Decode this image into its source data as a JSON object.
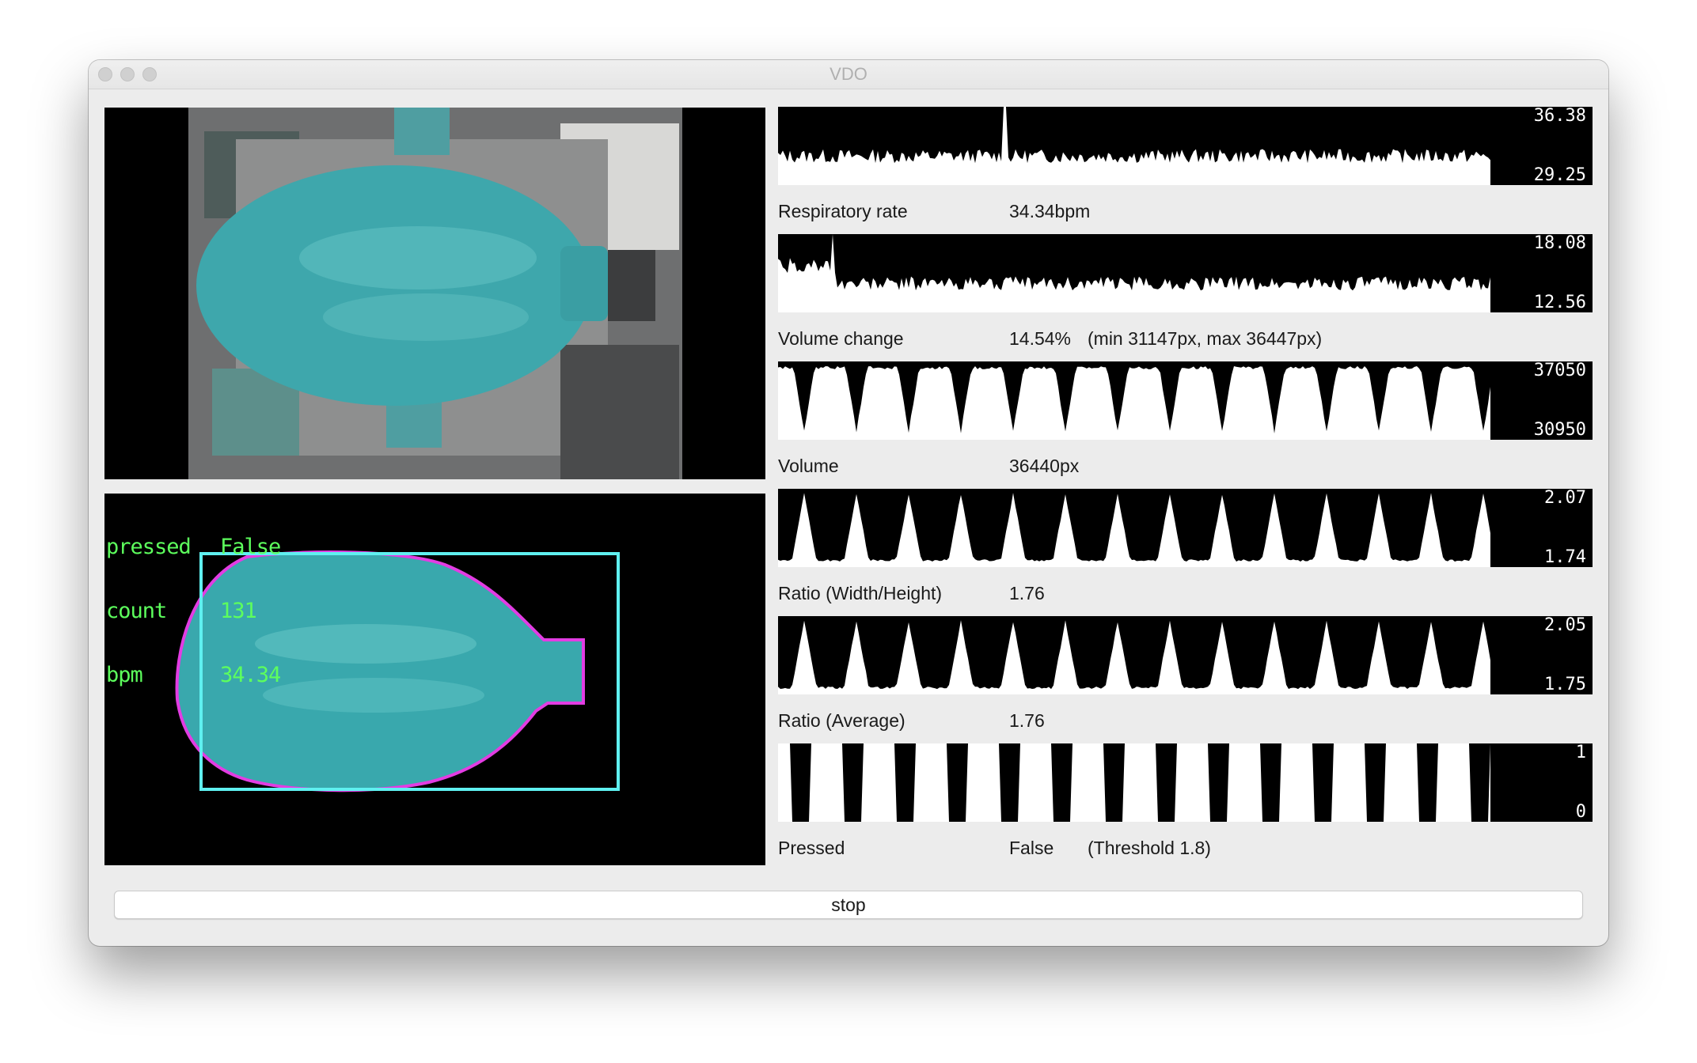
{
  "window": {
    "title": "VDO"
  },
  "overlay": {
    "rows": [
      {
        "key": "pressed",
        "value": "False"
      },
      {
        "key": "count",
        "value": "131"
      },
      {
        "key": "bpm",
        "value": "34.34"
      }
    ],
    "colors": {
      "text": "#5dff5d",
      "bbox": "#5ff0f0",
      "contour": "#e33ce3",
      "object": "#39a8ad"
    }
  },
  "metrics": [
    {
      "name": "Respiratory rate",
      "value": "34.34bpm",
      "extra": "",
      "max": "36.38",
      "min": "29.25",
      "pattern": "noisy"
    },
    {
      "name": "Volume change",
      "value": "14.54%",
      "extra": "(min 31147px, max 36447px)",
      "max": "18.08",
      "min": "12.56",
      "pattern": "noisy"
    },
    {
      "name": "Volume",
      "value": "36440px",
      "extra": "",
      "max": "37050",
      "min": "30950",
      "pattern": "valleys"
    },
    {
      "name": "Ratio (Width/Height)",
      "value": "1.76",
      "extra": "",
      "max": "2.07",
      "min": "1.74",
      "pattern": "peaks"
    },
    {
      "name": "Ratio (Average)",
      "value": "1.76",
      "extra": "",
      "max": "2.05",
      "min": "1.75",
      "pattern": "peaks"
    },
    {
      "name": "Pressed",
      "value": "False",
      "extra": "(Threshold 1.8)",
      "max": "1",
      "min": "0",
      "pattern": "square"
    }
  ],
  "controls": {
    "stop_label": "stop"
  }
}
